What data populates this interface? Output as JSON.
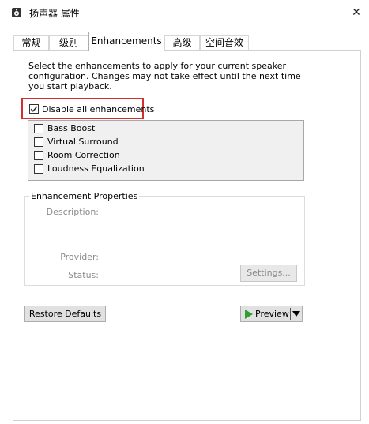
{
  "window": {
    "title": "扬声器 属性",
    "close_glyph": "✕"
  },
  "tabs": [
    {
      "label": "常规"
    },
    {
      "label": "级别"
    },
    {
      "label": "Enhancements"
    },
    {
      "label": "高级"
    },
    {
      "label": "空间音效"
    }
  ],
  "active_tab": "Enhancements",
  "description": "Select the enhancements to apply for your current speaker configuration. Changes may not take effect until the next time you start playback.",
  "disable_all": {
    "label": "Disable all enhancements",
    "checked": true
  },
  "enhancements": [
    {
      "label": "Bass Boost",
      "checked": false
    },
    {
      "label": "Virtual Surround",
      "checked": false
    },
    {
      "label": "Room Correction",
      "checked": false
    },
    {
      "label": "Loudness Equalization",
      "checked": false
    }
  ],
  "properties": {
    "title": "Enhancement Properties",
    "description_label": "Description:",
    "provider_label": "Provider:",
    "status_label": "Status:",
    "settings_button": "Settings..."
  },
  "buttons": {
    "restore_defaults": "Restore Defaults",
    "preview": "Preview"
  },
  "icons": {
    "window": "speaker-icon",
    "preview_play": "play-icon",
    "preview_dropdown": "dropdown-arrow-icon"
  },
  "colors": {
    "highlight_border": "#d32f2f",
    "play_green": "#2e9e2e",
    "disabled_text": "#8a8a8a"
  }
}
